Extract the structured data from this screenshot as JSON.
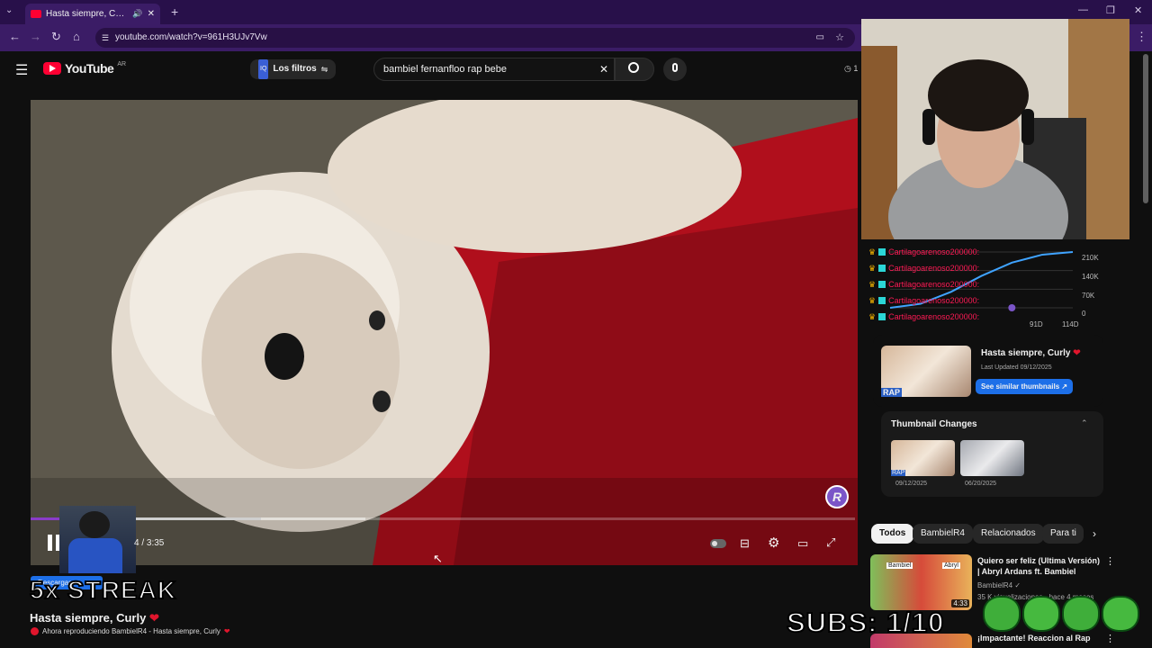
{
  "browser": {
    "tab_title": "Hasta siempre, Curly ❤ - YouTube",
    "url": "youtube.com/watch?v=961H3UJv7Vw"
  },
  "youtube": {
    "logo_text": "YouTube",
    "country": "AR",
    "filters_label": "Los filtros",
    "search_query": "bambiel fernanfloo rap bebe",
    "timer_fragment": "1"
  },
  "player": {
    "time": "4 / 3:35",
    "progress": 0.175,
    "buffered": 0.32,
    "overlay_badge": "Descargar"
  },
  "video": {
    "title": "Hasta siempre, Curly",
    "heart": "❤",
    "now_playing": "Ahora reproduciendo BambielR4 - Hasta siempre, Curly"
  },
  "overlays": {
    "streak": "5x STREAK",
    "subs": "SUBS: 1/10"
  },
  "chat": {
    "user": "cartilagoarenoso200000",
    "lines": [
      "Cartilagoarenoso200000:",
      "Cartilagoarenoso200000:",
      "Cartilagoarenoso200000:",
      "Cartilagoarenoso200000:",
      "Cartilagoarenoso200000:"
    ]
  },
  "chart_data": {
    "type": "line",
    "title": "",
    "y_ticks": [
      "210K",
      "140K",
      "70K",
      "0"
    ],
    "x_ticks": [
      "91D",
      "114D"
    ],
    "ylim": [
      0,
      210000
    ],
    "series": [
      {
        "values": [
          0,
          15000,
          60000,
          120000,
          170000,
          200000,
          210000
        ]
      }
    ],
    "grid": true
  },
  "thumbnail_panel": {
    "video_title": "Hasta siempre, Curly",
    "heart": "❤",
    "last_updated": "Last Updated 09/12/2025",
    "similar_button": "See similar thumbnails",
    "thumb_rap_label": "RAP",
    "changes_title": "Thumbnail Changes",
    "changes": [
      {
        "date": "09/12/2025",
        "label": "RAP"
      },
      {
        "date": "06/20/2025",
        "label": ""
      }
    ]
  },
  "filter_chips": [
    "Todos",
    "BambielR4",
    "Relacionados",
    "Para ti"
  ],
  "recommended": [
    {
      "title": "Quiero ser feliz (Ultima Versión) | Abryl Ardans ft. Bambiel",
      "channel": "BambielR4",
      "meta": "35 K visualizaciones · hace 4 meses",
      "duration": "4:33",
      "thumb_labels": [
        "Bambiel",
        "Abryl"
      ]
    },
    {
      "title": "¡Impactante! Reaccion al Rap",
      "channel": "",
      "meta": "",
      "duration": "",
      "thumb_labels": []
    }
  ],
  "colors": {
    "accent_blue": "#1d6fe8",
    "chat_red": "#ff1a55",
    "browser_purple": "#3b1c66",
    "yt_red": "#ff0033"
  }
}
